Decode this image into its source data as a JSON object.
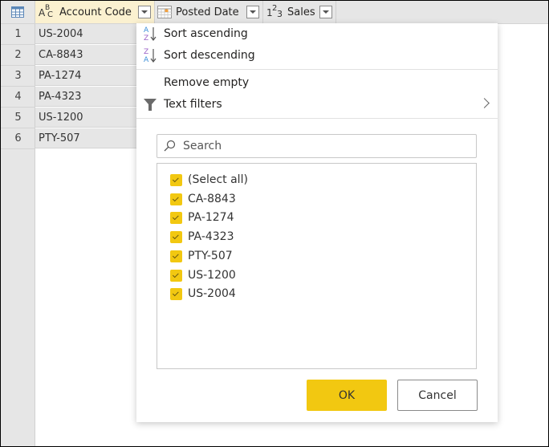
{
  "table": {
    "columns": [
      {
        "name": "Account Code",
        "type_icon": "text-type-icon",
        "type_glyph": "ABC",
        "active": true
      },
      {
        "name": "Posted Date",
        "type_icon": "date-type-icon",
        "type_glyph": "calendar",
        "active": false
      },
      {
        "name": "Sales",
        "type_icon": "number-type-icon",
        "type_glyph": "123",
        "active": false
      }
    ],
    "rows": [
      {
        "num": "1",
        "account_code": "US-2004"
      },
      {
        "num": "2",
        "account_code": "CA-8843"
      },
      {
        "num": "3",
        "account_code": "PA-1274"
      },
      {
        "num": "4",
        "account_code": "PA-4323"
      },
      {
        "num": "5",
        "account_code": "US-1200"
      },
      {
        "num": "6",
        "account_code": "PTY-507"
      }
    ]
  },
  "filter_menu": {
    "sort_ascending": "Sort ascending",
    "sort_descending": "Sort descending",
    "remove_empty": "Remove empty",
    "text_filters": "Text filters",
    "search_placeholder": "Search",
    "options": [
      {
        "label": "(Select all)",
        "checked": true
      },
      {
        "label": "CA-8843",
        "checked": true
      },
      {
        "label": "PA-1274",
        "checked": true
      },
      {
        "label": "PA-4323",
        "checked": true
      },
      {
        "label": "PTY-507",
        "checked": true
      },
      {
        "label": "US-1200",
        "checked": true
      },
      {
        "label": "US-2004",
        "checked": true
      }
    ],
    "ok_label": "OK",
    "cancel_label": "Cancel"
  },
  "colors": {
    "accent": "#F2C811",
    "active_header": "#FBF1D0",
    "grid_gray": "#E6E6E6"
  }
}
